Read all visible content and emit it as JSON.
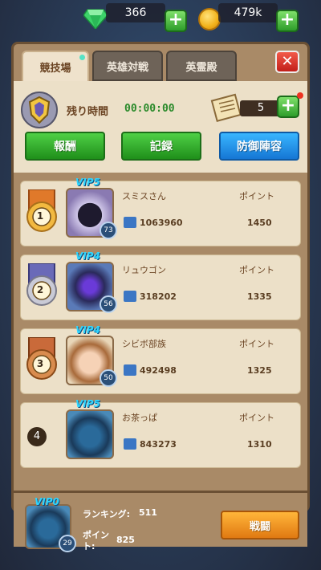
{
  "currency": {
    "gems": "366",
    "gold": "479k",
    "gem_icon": "emerald-gem-icon",
    "gold_icon": "gold-coin-icon"
  },
  "tabs": [
    {
      "label": "競技場",
      "active": true
    },
    {
      "label": "英雄対戦",
      "active": false
    },
    {
      "label": "英霊殿",
      "active": false
    }
  ],
  "header": {
    "remaining_label": "残り時間",
    "remaining_time": "00:00:00",
    "ticket_count": "5"
  },
  "actions": {
    "rewards": "報酬",
    "records": "記録",
    "defense": "防御陣容"
  },
  "ranking": [
    {
      "rank": "1",
      "vip": "VIP5",
      "level": "73",
      "name": "スミスさん",
      "guild_value": "1063960",
      "point_label": "ポイント",
      "points": "1450"
    },
    {
      "rank": "2",
      "vip": "VIP4",
      "level": "56",
      "name": "リュウゴン",
      "guild_value": "318202",
      "point_label": "ポイント",
      "points": "1335"
    },
    {
      "rank": "3",
      "vip": "VIP4",
      "level": "50",
      "name": "シビボ部族",
      "guild_value": "492498",
      "point_label": "ポイント",
      "points": "1325"
    },
    {
      "rank": "4",
      "vip": "VIP5",
      "level": "",
      "name": "お茶っぱ",
      "guild_value": "843273",
      "point_label": "ポイント",
      "points": "1310"
    }
  ],
  "self": {
    "vip": "VIP0",
    "level": "29",
    "rank_label": "ランキング:",
    "rank_value": "511",
    "points_label": "ポイント:",
    "points_value": "825",
    "battle_button": "戦闘"
  },
  "colors": {
    "accent_green": "#2e9d2a",
    "accent_blue": "#1576d4",
    "accent_orange": "#e07912",
    "close_red": "#c21f1a"
  }
}
